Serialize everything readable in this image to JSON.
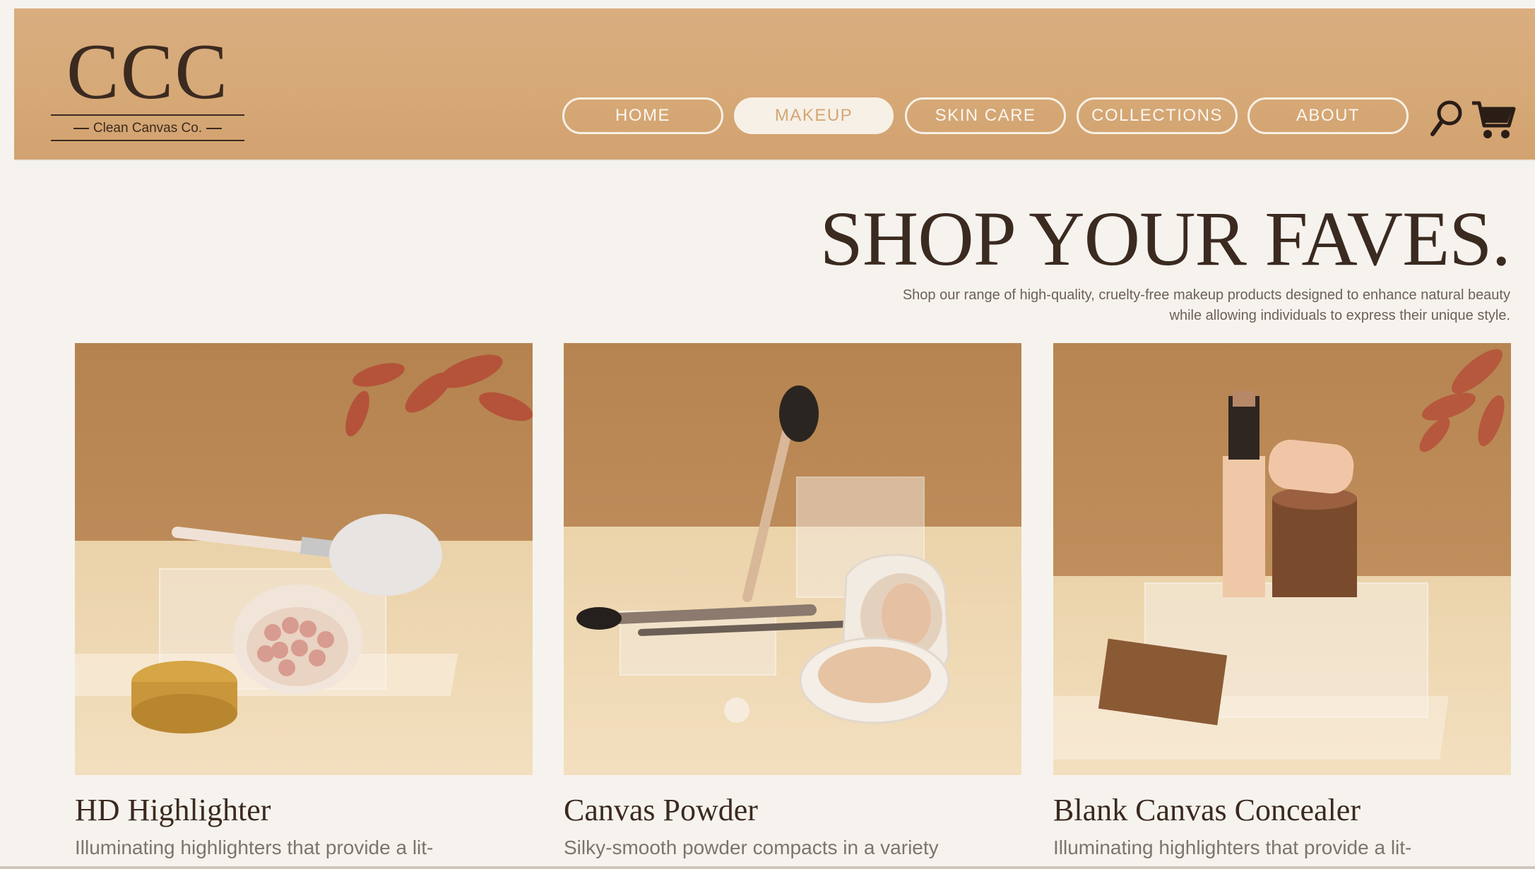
{
  "header": {
    "logo_mark": "CCC",
    "logo_sub": "Clean Canvas Co."
  },
  "nav": {
    "items": [
      {
        "label": "HOME",
        "active": false
      },
      {
        "label": "MAKEUP",
        "active": true
      },
      {
        "label": "SKIN CARE",
        "active": false
      },
      {
        "label": "COLLECTIONS",
        "active": false
      },
      {
        "label": "ABOUT",
        "active": false
      }
    ],
    "search_icon": "search-icon",
    "cart_icon": "cart-icon"
  },
  "hero": {
    "title": "SHOP YOUR FAVES.",
    "subtitle_line1": "Shop our range of high-quality, cruelty-free makeup products designed to enhance natural beauty",
    "subtitle_line2": "while allowing individuals to express their unique style."
  },
  "products": [
    {
      "name": "HD Highlighter",
      "description": "Illuminating highlighters that provide a lit-"
    },
    {
      "name": "Canvas Powder",
      "description": "Silky-smooth powder compacts in a variety"
    },
    {
      "name": "Blank Canvas Concealer",
      "description": "Illuminating highlighters that provide a lit-"
    }
  ],
  "colors": {
    "header_bg": "#d6a977",
    "page_bg": "#f6f3ee",
    "text_dark": "#3b2a20",
    "nav_text": "#fbf6ef",
    "active_text": "#d3a675"
  }
}
